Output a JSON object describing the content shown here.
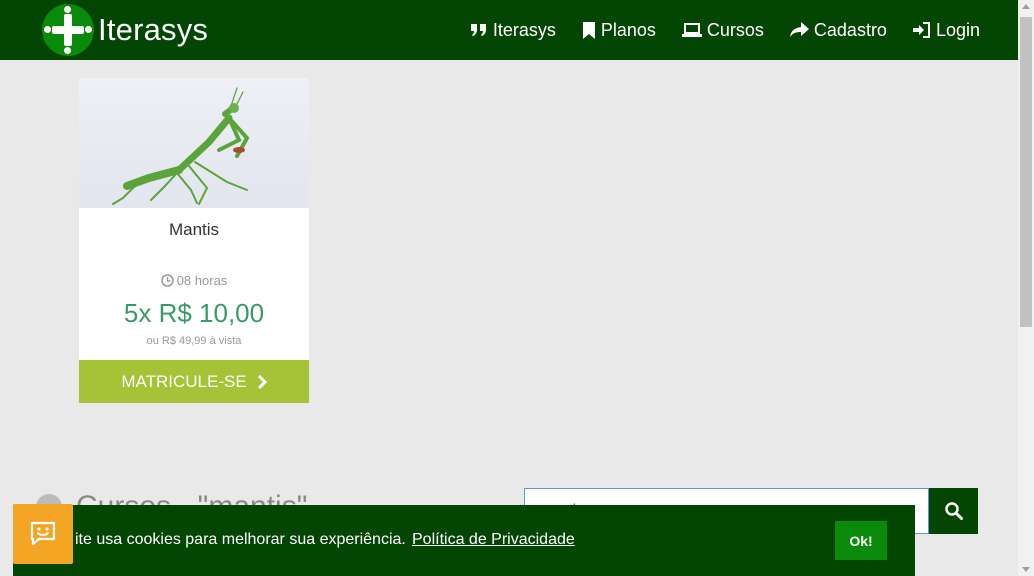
{
  "brand": {
    "name": "Iterasys"
  },
  "nav": {
    "items": [
      {
        "label": "Iterasys",
        "icon": "quote-icon"
      },
      {
        "label": "Planos",
        "icon": "bookmark-icon"
      },
      {
        "label": "Cursos",
        "icon": "laptop-icon"
      },
      {
        "label": "Cadastro",
        "icon": "share-icon"
      },
      {
        "label": "Login",
        "icon": "sign-in-icon"
      }
    ]
  },
  "course": {
    "title": "Mantis",
    "hours": "08 horas",
    "installments": "5x R$ 10,00",
    "full_price": "ou R$ 49,99 à vista",
    "enroll_label": "MATRICULE-SE"
  },
  "search": {
    "heading": "Cursos - \"mantis\"",
    "value": "mantis"
  },
  "cookie": {
    "text": "ite usa cookies para melhorar sua experiência.",
    "link": "Política de Privacidade",
    "ok": "Ok!"
  },
  "colors": {
    "navbar": "#034503",
    "accent_green": "#0a8a0a",
    "enroll_button": "#a6c236",
    "price": "#3a9a6a",
    "chat_button": "#f5a524"
  }
}
